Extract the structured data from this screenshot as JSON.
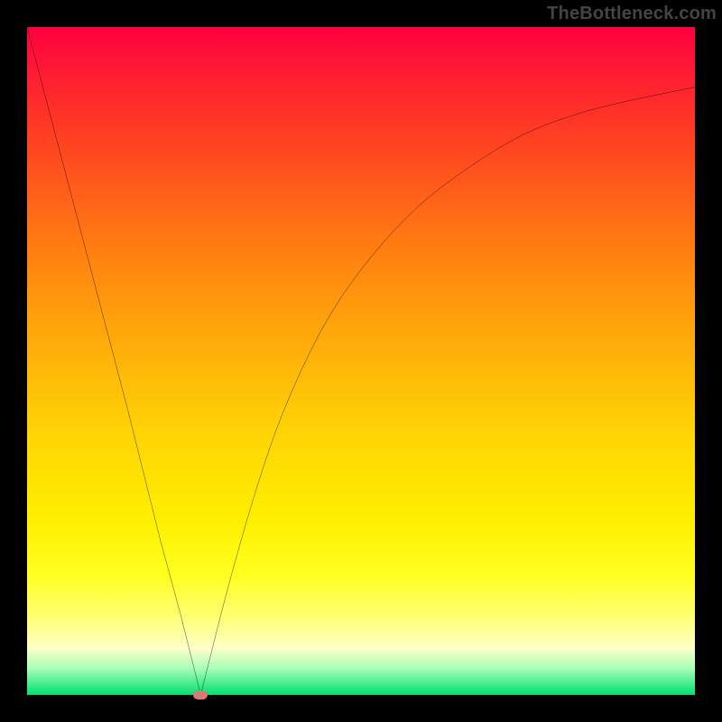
{
  "attribution": "TheBottleneck.com",
  "chart_data": {
    "type": "line",
    "title": "",
    "xlabel": "",
    "ylabel": "",
    "xlim": [
      0,
      100
    ],
    "ylim": [
      0,
      100
    ],
    "grid": false,
    "legend": false,
    "series": [
      {
        "name": "bottleneck-curve",
        "x": [
          0,
          5,
          10,
          15,
          20,
          23,
          26,
          30,
          34,
          38,
          44,
          50,
          58,
          66,
          74,
          82,
          90,
          100
        ],
        "values": [
          100,
          81,
          62,
          43,
          23,
          12,
          0,
          16,
          30,
          42,
          55,
          64,
          73,
          79,
          84,
          87,
          89,
          91
        ]
      }
    ],
    "optimum_marker": {
      "x": 26,
      "y": 0
    },
    "background_gradient": {
      "top": "#ff0040",
      "mid": "#ffff20",
      "bottom": "#00e070"
    }
  }
}
